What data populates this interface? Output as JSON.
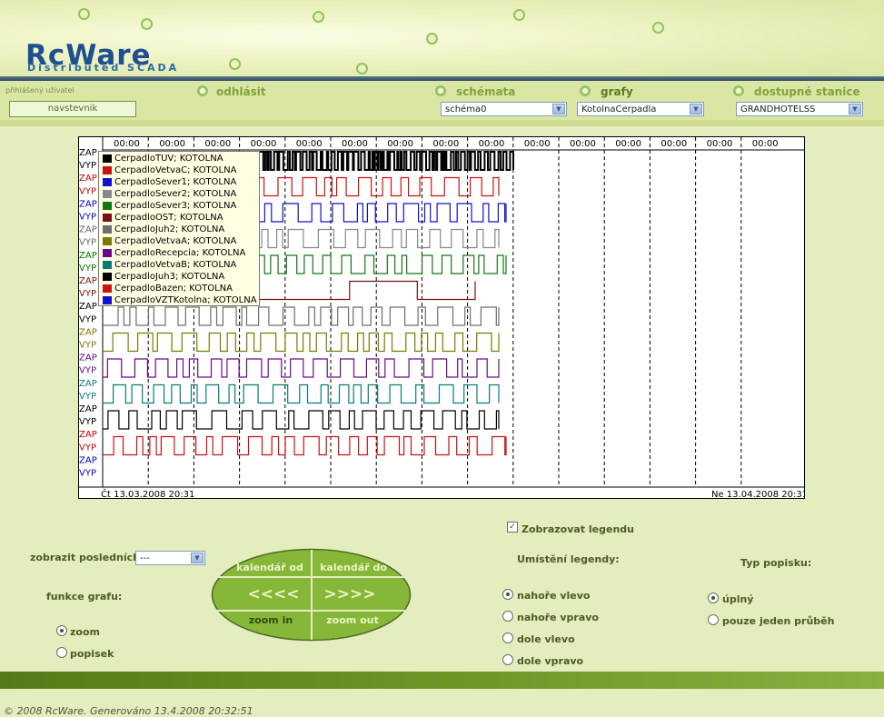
{
  "app": {
    "logo": "RcWare",
    "logo_sub": "Distributed SCADA"
  },
  "header": {
    "user_label": "přihlášený uživatel",
    "user_name": "navstevnik",
    "logout": "odhlásit",
    "schemes_label": "schémata",
    "schemes_value": "schéma0",
    "graphs_label": "grafy",
    "graphs_value": "KotolnaCerpadla",
    "stations_label": "dostupné stanice",
    "stations_value": "GRANDHOTELSS"
  },
  "chart": {
    "time_ticks": [
      "00:00",
      "00:00",
      "00:00",
      "00:00",
      "00:00",
      "00:00",
      "00:00",
      "00:00",
      "00:00",
      "00:00",
      "00:00",
      "00:00",
      "00:00",
      "00:00",
      "00:00"
    ],
    "y_labels": [
      {
        "text": "ZAP",
        "color": "#000000"
      },
      {
        "text": "VYP",
        "color": "#000000"
      },
      {
        "text": "ZAP",
        "color": "#cc0000"
      },
      {
        "text": "VYP",
        "color": "#cc0000"
      },
      {
        "text": "ZAP",
        "color": "#0000cc"
      },
      {
        "text": "VYP",
        "color": "#0000cc"
      },
      {
        "text": "ZAP",
        "color": "#666666"
      },
      {
        "text": "VYP",
        "color": "#666666"
      },
      {
        "text": "ZAP",
        "color": "#007700"
      },
      {
        "text": "VYP",
        "color": "#007700"
      },
      {
        "text": "ZAP",
        "color": "#7a1010"
      },
      {
        "text": "VYP",
        "color": "#7a1010"
      },
      {
        "text": "ZAP",
        "color": "#000000"
      },
      {
        "text": "VYP",
        "color": "#000000"
      },
      {
        "text": "ZAP",
        "color": "#7a7a00"
      },
      {
        "text": "VYP",
        "color": "#7a7a00"
      },
      {
        "text": "ZAP",
        "color": "#6a0a8a"
      },
      {
        "text": "VYP",
        "color": "#6a0a8a"
      },
      {
        "text": "ZAP",
        "color": "#0a7a8a"
      },
      {
        "text": "VYP",
        "color": "#0a7a8a"
      },
      {
        "text": "ZAP",
        "color": "#000000"
      },
      {
        "text": "VYP",
        "color": "#000000"
      },
      {
        "text": "ZAP",
        "color": "#cc0000"
      },
      {
        "text": "VYP",
        "color": "#cc0000"
      },
      {
        "text": "ZAP",
        "color": "#0000cc"
      },
      {
        "text": "VYP",
        "color": "#0000cc"
      }
    ],
    "start_label": "Čt 13.03.2008 20:31",
    "end_label": "Ne 13.04.2008 20:31"
  },
  "chart_data": {
    "type": "line",
    "title": "",
    "xlabel": "",
    "ylabel": "",
    "x_range": [
      "Čt 13.03.2008 20:31",
      "Ne 13.04.2008 20:31"
    ],
    "y_states": [
      "VYP",
      "ZAP"
    ],
    "series": [
      {
        "name": "CerpadloTUV; KOTOLNA",
        "color": "#000000"
      },
      {
        "name": "CerpadloVetvaC; KOTOLNA",
        "color": "#cc1111"
      },
      {
        "name": "CerpadloSever1; KOTOLNA",
        "color": "#1111cc"
      },
      {
        "name": "CerpadloSever2; KOTOLNA",
        "color": "#888888"
      },
      {
        "name": "CerpadloSever3; KOTOLNA",
        "color": "#117711"
      },
      {
        "name": "CerpadloOST; KOTOLNA",
        "color": "#771111"
      },
      {
        "name": "CerpadloJuh2; KOTOLNA",
        "color": "#6e6e6e"
      },
      {
        "name": "CerpadloVetvaA; KOTOLNA",
        "color": "#7a7a00"
      },
      {
        "name": "CerpadloRecepcia; KOTOLNA",
        "color": "#6a0a8a"
      },
      {
        "name": "CerpadloVetvaB; KOTOLNA",
        "color": "#0a7a7a"
      },
      {
        "name": "CerpadloJuh3; KOTOLNA",
        "color": "#000000"
      },
      {
        "name": "CerpadloBazen; KOTOLNA",
        "color": "#cc1111"
      },
      {
        "name": "CerpadloVZTKotolna; KOTOLNA",
        "color": "#1111cc"
      }
    ]
  },
  "controls": {
    "show_last_label": "zobrazit posledních:",
    "show_last_value": "---",
    "function_label": "funkce grafu:",
    "zoom": "zoom",
    "popisek": "popisek",
    "cal_from": "kalendář od",
    "cal_to": "kalendář do",
    "back": "<<<<",
    "forward": ">>>>",
    "zoom_in": "zoom in",
    "zoom_out": "zoom out",
    "show_legend": "Zobrazovat legendu",
    "legend_pos_label": "Umístění legendy:",
    "pos_tl": "nahoře vlevo",
    "pos_tr": "nahoře vpravo",
    "pos_bl": "dole vlevo",
    "pos_br": "dole vpravo",
    "label_type_label": "Typ popisku:",
    "full": "úplný",
    "single": "pouze jeden průběh"
  },
  "footer": {
    "text": "© 2008 RcWare. Generováno 13.4.2008 20:32:51"
  }
}
